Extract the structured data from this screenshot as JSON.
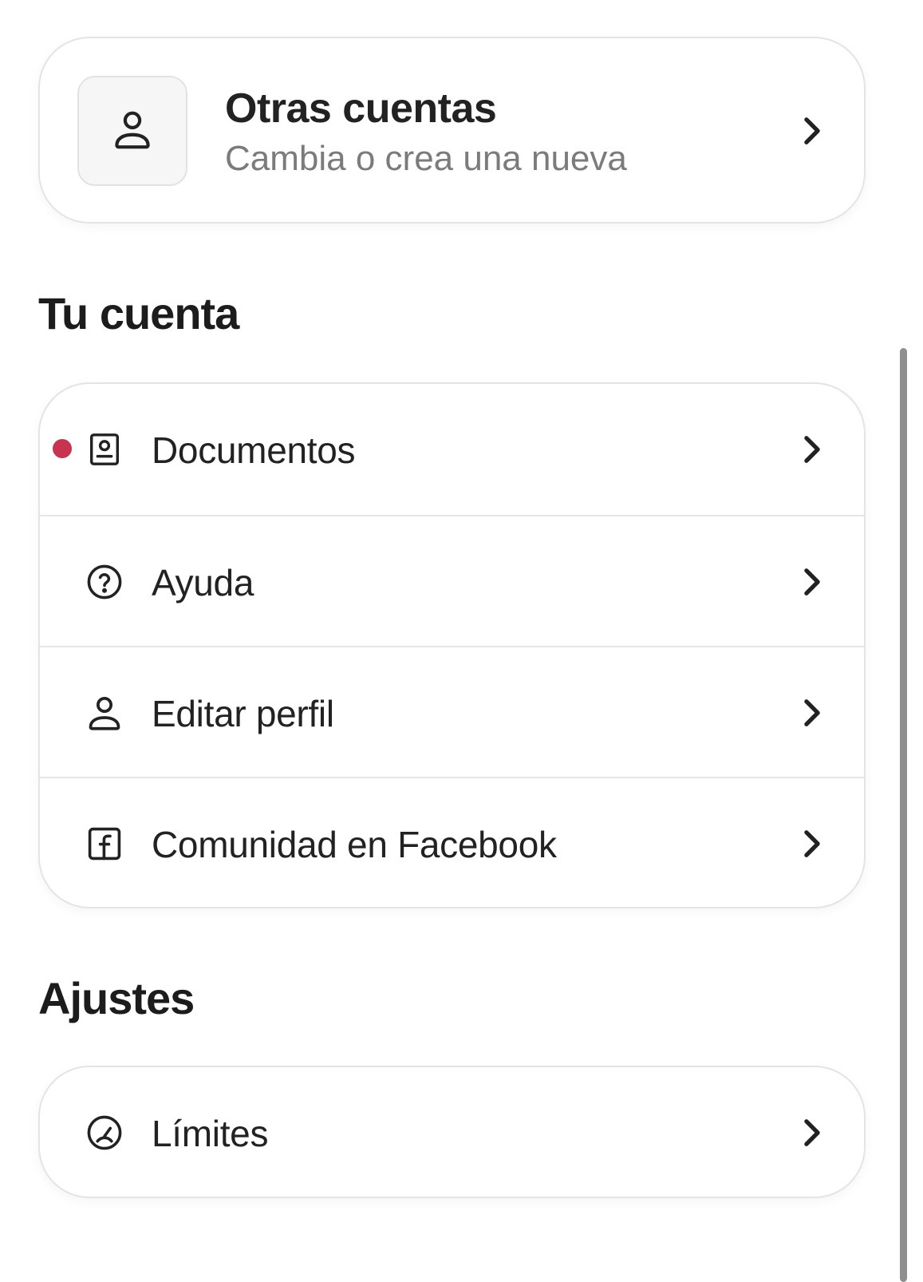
{
  "accounts": {
    "title": "Otras cuentas",
    "subtitle": "Cambia o crea una nueva",
    "icon": "user-icon"
  },
  "sections": {
    "account": "Tu cuenta",
    "settings": "Ajustes"
  },
  "account_items": [
    {
      "label": "Documentos",
      "icon": "id-document-icon",
      "badge": true
    },
    {
      "label": "Ayuda",
      "icon": "help-circle-icon"
    },
    {
      "label": "Editar perfil",
      "icon": "user-icon"
    },
    {
      "label": "Comunidad en Facebook",
      "icon": "facebook-icon"
    }
  ],
  "settings_items": [
    {
      "label": "Límites",
      "icon": "gauge-icon"
    }
  ],
  "colors": {
    "badge": "#c8344f",
    "text": "#222222",
    "secondary_text": "#7b7b7b",
    "border": "#e4e4e4"
  }
}
